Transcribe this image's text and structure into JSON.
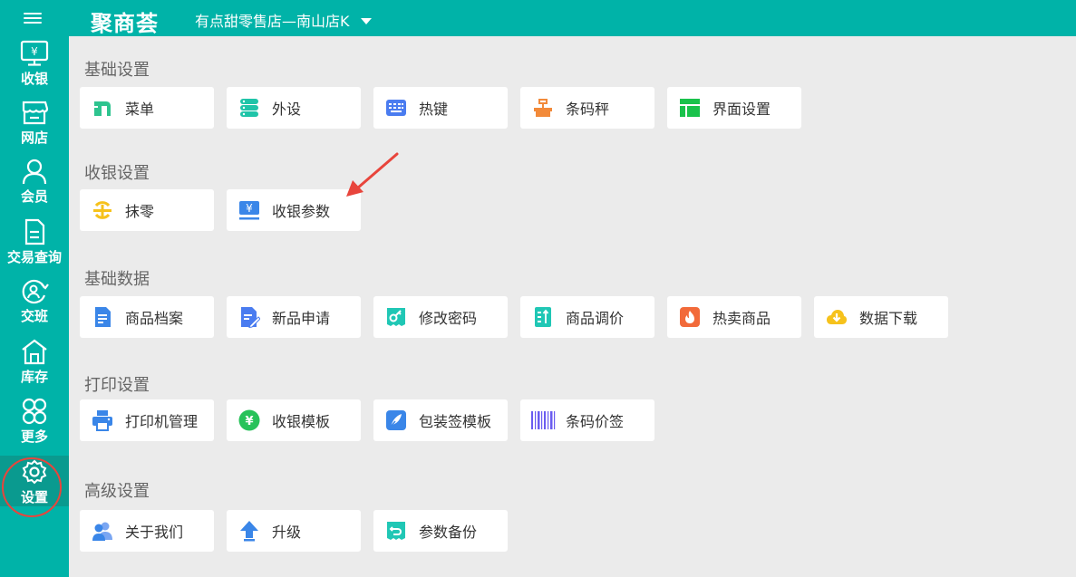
{
  "header": {
    "brand": "聚商荟",
    "store_name": "有点甜零售店—南山店K"
  },
  "sidebar": {
    "items": [
      {
        "label": "收银",
        "icon": "monitor-yuan-icon"
      },
      {
        "label": "网店",
        "icon": "store-icon"
      },
      {
        "label": "会员",
        "icon": "user-icon"
      },
      {
        "label": "交易查询",
        "icon": "document-icon"
      },
      {
        "label": "交班",
        "icon": "shift-handover-icon"
      },
      {
        "label": "库存",
        "icon": "warehouse-icon"
      },
      {
        "label": "更多",
        "icon": "more-grid-icon"
      },
      {
        "label": "设置",
        "icon": "gear-icon",
        "active": true
      }
    ]
  },
  "sections": [
    {
      "title": "基础设置",
      "items": [
        {
          "label": "菜单",
          "icon": "menu-icon"
        },
        {
          "label": "外设",
          "icon": "peripheral-icon"
        },
        {
          "label": "热键",
          "icon": "keyboard-icon"
        },
        {
          "label": "条码秤",
          "icon": "scale-icon"
        },
        {
          "label": "界面设置",
          "icon": "layout-icon"
        }
      ]
    },
    {
      "title": "收银设置",
      "items": [
        {
          "label": "抹零",
          "icon": "round-off-icon"
        },
        {
          "label": "收银参数",
          "icon": "cashier-param-icon"
        }
      ]
    },
    {
      "title": "基础数据",
      "items": [
        {
          "label": "商品档案",
          "icon": "product-file-icon"
        },
        {
          "label": "新品申请",
          "icon": "new-product-icon"
        },
        {
          "label": "修改密码",
          "icon": "key-icon"
        },
        {
          "label": "商品调价",
          "icon": "price-adjust-icon"
        },
        {
          "label": "热卖商品",
          "icon": "hot-icon"
        },
        {
          "label": "数据下载",
          "icon": "download-cloud-icon"
        }
      ]
    },
    {
      "title": "打印设置",
      "items": [
        {
          "label": "打印机管理",
          "icon": "printer-icon"
        },
        {
          "label": "收银模板",
          "icon": "yuan-template-icon"
        },
        {
          "label": "包装签模板",
          "icon": "feather-icon"
        },
        {
          "label": "条码价签",
          "icon": "barcode-icon"
        }
      ]
    },
    {
      "title": "高级设置",
      "items": [
        {
          "label": "关于我们",
          "icon": "about-users-icon"
        },
        {
          "label": "升级",
          "icon": "upgrade-arrow-icon"
        },
        {
          "label": "参数备份",
          "icon": "backup-icon"
        }
      ]
    }
  ],
  "colors": {
    "accent": "#00b3a8",
    "active_nav": "#0a9a8f",
    "annotation": "#e8453c"
  }
}
